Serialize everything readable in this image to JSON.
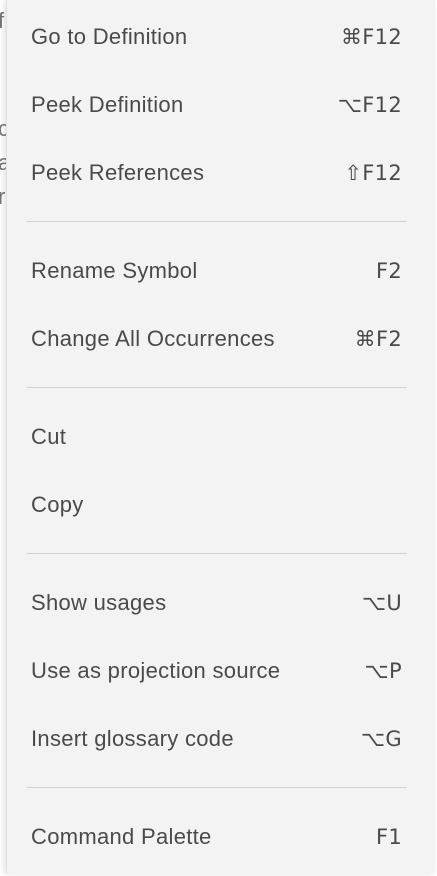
{
  "background_peek": {
    "glyphs": [
      "f",
      "c",
      "a",
      "r"
    ]
  },
  "menu": {
    "groups": [
      {
        "items": [
          {
            "label": "Go to Definition",
            "shortcut": "⌘F12"
          },
          {
            "label": "Peek Definition",
            "shortcut": "⌥F12"
          },
          {
            "label": "Peek References",
            "shortcut": "⇧F12"
          }
        ]
      },
      {
        "items": [
          {
            "label": "Rename Symbol",
            "shortcut": "F2"
          },
          {
            "label": "Change All Occurrences",
            "shortcut": "⌘F2"
          }
        ]
      },
      {
        "items": [
          {
            "label": "Cut",
            "shortcut": ""
          },
          {
            "label": "Copy",
            "shortcut": ""
          }
        ]
      },
      {
        "items": [
          {
            "label": "Show usages",
            "shortcut": "⌥U"
          },
          {
            "label": "Use as projection source",
            "shortcut": "⌥P"
          },
          {
            "label": "Insert glossary code",
            "shortcut": "⌥G"
          }
        ]
      },
      {
        "items": [
          {
            "label": "Command Palette",
            "shortcut": "F1"
          }
        ]
      }
    ]
  }
}
